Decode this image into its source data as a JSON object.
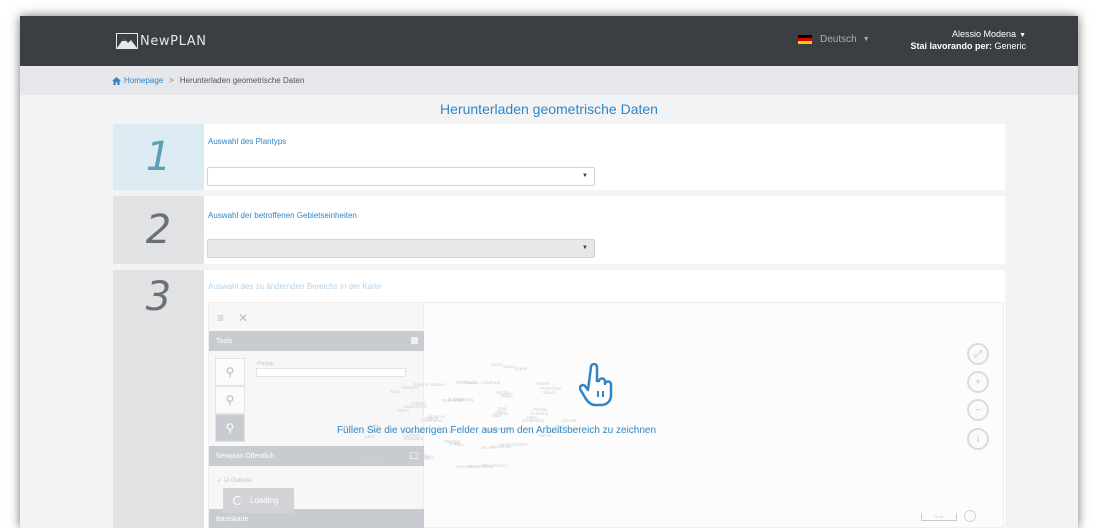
{
  "app": {
    "name": "NewPLAN"
  },
  "header": {
    "language": "Deutsch",
    "user_name": "Alessio Modena",
    "working_for_label": "Stai lavorando per:",
    "working_for_value": "Generic",
    "flag_colors": [
      "#000000",
      "#dd0000",
      "#ffce00"
    ]
  },
  "breadcrumb": {
    "home": "Homepage",
    "current": "Herunterladen geometrische Daten"
  },
  "page": {
    "title": "Herunterladen geometrische Daten"
  },
  "steps": [
    {
      "number": "1",
      "label": "Auswahl des Plantyps",
      "value": "",
      "state": "active"
    },
    {
      "number": "2",
      "label": "Auswahl der betroffenen Gebietseinheiten",
      "value": "",
      "state": "disabled"
    },
    {
      "number": "3",
      "label": "Auswahl des zu ändernden Bereichs in der Karte",
      "state": "inactive"
    }
  ],
  "map": {
    "message": "Füllen Sie die vorherigen Felder aus um den Arbeitsbereich zu zeichnen",
    "panel": {
      "tools_title": "Tools",
      "tools_field_label": "Plantyp",
      "layer_title": "Newplan Öffentlich",
      "layer_item": "Gebiete",
      "basemap_title": "Basiskarte",
      "loading": "Loading"
    },
    "scale": "20 km",
    "place_names": [
      "Mals",
      "Schlanders",
      "Meran",
      "Bozen",
      "Brixen",
      "Bruneck",
      "Sterzing",
      "Klausen",
      "Kaltern",
      "Neumarkt",
      "Lana",
      "Naturns",
      "Toblach",
      "Sand in Taufers",
      "Welsberg",
      "St. Leonhard",
      "Eppan",
      "Auer",
      "Salurn",
      "Tramin",
      "Ulten",
      "Sarntal",
      "Ritten",
      "Kastelruth",
      "Wolkenstein",
      "Abtei",
      "Enneberg",
      "Olang",
      "Innichen",
      "Sexten",
      "Pfitsch",
      "Ratschings",
      "Passeier",
      "Schnals",
      "Prad",
      "Laas",
      "Latsch",
      "Partschins",
      "Tirol",
      "Schenna",
      "Terlan",
      "Jenesien",
      "Deutschnofen",
      "Welschnofen",
      "Tiers",
      "Völs",
      "Barbian",
      "Villanders",
      "Lajen",
      "Feldthurns",
      "Vahrn",
      "Natz",
      "Rodeneck",
      "Mühlbach",
      "Kiens",
      "Percha",
      "Rasen",
      "Gais",
      "Prettau",
      "Ahrntal"
    ]
  }
}
